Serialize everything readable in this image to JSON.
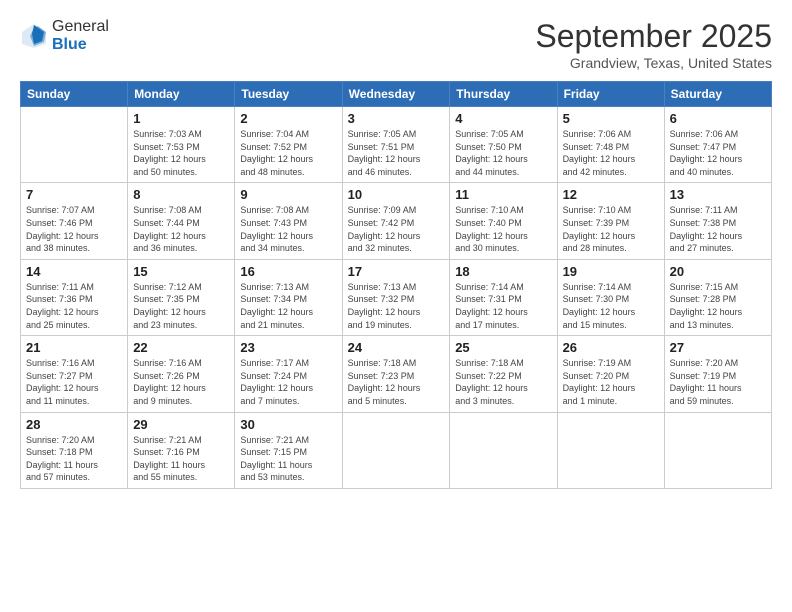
{
  "header": {
    "logo": {
      "general": "General",
      "blue": "Blue"
    },
    "title": "September 2025",
    "location": "Grandview, Texas, United States"
  },
  "days_of_week": [
    "Sunday",
    "Monday",
    "Tuesday",
    "Wednesday",
    "Thursday",
    "Friday",
    "Saturday"
  ],
  "weeks": [
    [
      {
        "num": "",
        "info": ""
      },
      {
        "num": "1",
        "info": "Sunrise: 7:03 AM\nSunset: 7:53 PM\nDaylight: 12 hours\nand 50 minutes."
      },
      {
        "num": "2",
        "info": "Sunrise: 7:04 AM\nSunset: 7:52 PM\nDaylight: 12 hours\nand 48 minutes."
      },
      {
        "num": "3",
        "info": "Sunrise: 7:05 AM\nSunset: 7:51 PM\nDaylight: 12 hours\nand 46 minutes."
      },
      {
        "num": "4",
        "info": "Sunrise: 7:05 AM\nSunset: 7:50 PM\nDaylight: 12 hours\nand 44 minutes."
      },
      {
        "num": "5",
        "info": "Sunrise: 7:06 AM\nSunset: 7:48 PM\nDaylight: 12 hours\nand 42 minutes."
      },
      {
        "num": "6",
        "info": "Sunrise: 7:06 AM\nSunset: 7:47 PM\nDaylight: 12 hours\nand 40 minutes."
      }
    ],
    [
      {
        "num": "7",
        "info": "Sunrise: 7:07 AM\nSunset: 7:46 PM\nDaylight: 12 hours\nand 38 minutes."
      },
      {
        "num": "8",
        "info": "Sunrise: 7:08 AM\nSunset: 7:44 PM\nDaylight: 12 hours\nand 36 minutes."
      },
      {
        "num": "9",
        "info": "Sunrise: 7:08 AM\nSunset: 7:43 PM\nDaylight: 12 hours\nand 34 minutes."
      },
      {
        "num": "10",
        "info": "Sunrise: 7:09 AM\nSunset: 7:42 PM\nDaylight: 12 hours\nand 32 minutes."
      },
      {
        "num": "11",
        "info": "Sunrise: 7:10 AM\nSunset: 7:40 PM\nDaylight: 12 hours\nand 30 minutes."
      },
      {
        "num": "12",
        "info": "Sunrise: 7:10 AM\nSunset: 7:39 PM\nDaylight: 12 hours\nand 28 minutes."
      },
      {
        "num": "13",
        "info": "Sunrise: 7:11 AM\nSunset: 7:38 PM\nDaylight: 12 hours\nand 27 minutes."
      }
    ],
    [
      {
        "num": "14",
        "info": "Sunrise: 7:11 AM\nSunset: 7:36 PM\nDaylight: 12 hours\nand 25 minutes."
      },
      {
        "num": "15",
        "info": "Sunrise: 7:12 AM\nSunset: 7:35 PM\nDaylight: 12 hours\nand 23 minutes."
      },
      {
        "num": "16",
        "info": "Sunrise: 7:13 AM\nSunset: 7:34 PM\nDaylight: 12 hours\nand 21 minutes."
      },
      {
        "num": "17",
        "info": "Sunrise: 7:13 AM\nSunset: 7:32 PM\nDaylight: 12 hours\nand 19 minutes."
      },
      {
        "num": "18",
        "info": "Sunrise: 7:14 AM\nSunset: 7:31 PM\nDaylight: 12 hours\nand 17 minutes."
      },
      {
        "num": "19",
        "info": "Sunrise: 7:14 AM\nSunset: 7:30 PM\nDaylight: 12 hours\nand 15 minutes."
      },
      {
        "num": "20",
        "info": "Sunrise: 7:15 AM\nSunset: 7:28 PM\nDaylight: 12 hours\nand 13 minutes."
      }
    ],
    [
      {
        "num": "21",
        "info": "Sunrise: 7:16 AM\nSunset: 7:27 PM\nDaylight: 12 hours\nand 11 minutes."
      },
      {
        "num": "22",
        "info": "Sunrise: 7:16 AM\nSunset: 7:26 PM\nDaylight: 12 hours\nand 9 minutes."
      },
      {
        "num": "23",
        "info": "Sunrise: 7:17 AM\nSunset: 7:24 PM\nDaylight: 12 hours\nand 7 minutes."
      },
      {
        "num": "24",
        "info": "Sunrise: 7:18 AM\nSunset: 7:23 PM\nDaylight: 12 hours\nand 5 minutes."
      },
      {
        "num": "25",
        "info": "Sunrise: 7:18 AM\nSunset: 7:22 PM\nDaylight: 12 hours\nand 3 minutes."
      },
      {
        "num": "26",
        "info": "Sunrise: 7:19 AM\nSunset: 7:20 PM\nDaylight: 12 hours\nand 1 minute."
      },
      {
        "num": "27",
        "info": "Sunrise: 7:20 AM\nSunset: 7:19 PM\nDaylight: 11 hours\nand 59 minutes."
      }
    ],
    [
      {
        "num": "28",
        "info": "Sunrise: 7:20 AM\nSunset: 7:18 PM\nDaylight: 11 hours\nand 57 minutes."
      },
      {
        "num": "29",
        "info": "Sunrise: 7:21 AM\nSunset: 7:16 PM\nDaylight: 11 hours\nand 55 minutes."
      },
      {
        "num": "30",
        "info": "Sunrise: 7:21 AM\nSunset: 7:15 PM\nDaylight: 11 hours\nand 53 minutes."
      },
      {
        "num": "",
        "info": ""
      },
      {
        "num": "",
        "info": ""
      },
      {
        "num": "",
        "info": ""
      },
      {
        "num": "",
        "info": ""
      }
    ]
  ]
}
